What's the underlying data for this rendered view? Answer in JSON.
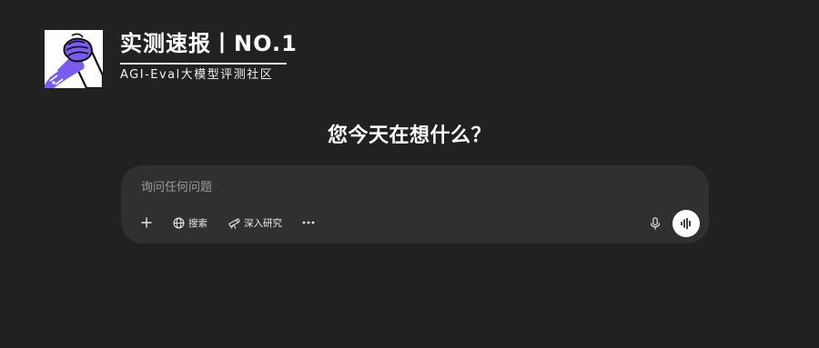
{
  "header": {
    "logo_icon": "arm-wrestling-hands-logo",
    "title": "实测速报丨NO.1",
    "subtitle": "AGI-Eval大模型评测社区"
  },
  "main": {
    "headline": "您今天在想什么？"
  },
  "composer": {
    "placeholder": "询问任何问题",
    "value": "",
    "tools": {
      "add_icon": "plus-icon",
      "search_label": "搜索",
      "search_icon": "globe-icon",
      "deep_research_label": "深入研究",
      "deep_research_icon": "telescope-icon",
      "more_icon": "more-horizontal-icon"
    },
    "mic_icon": "microphone-icon",
    "voice_icon": "voice-waveform-icon"
  },
  "colors": {
    "background": "#212121",
    "composer": "#303030",
    "logo_purple": "#7b5cf0",
    "text": "#ececec"
  }
}
